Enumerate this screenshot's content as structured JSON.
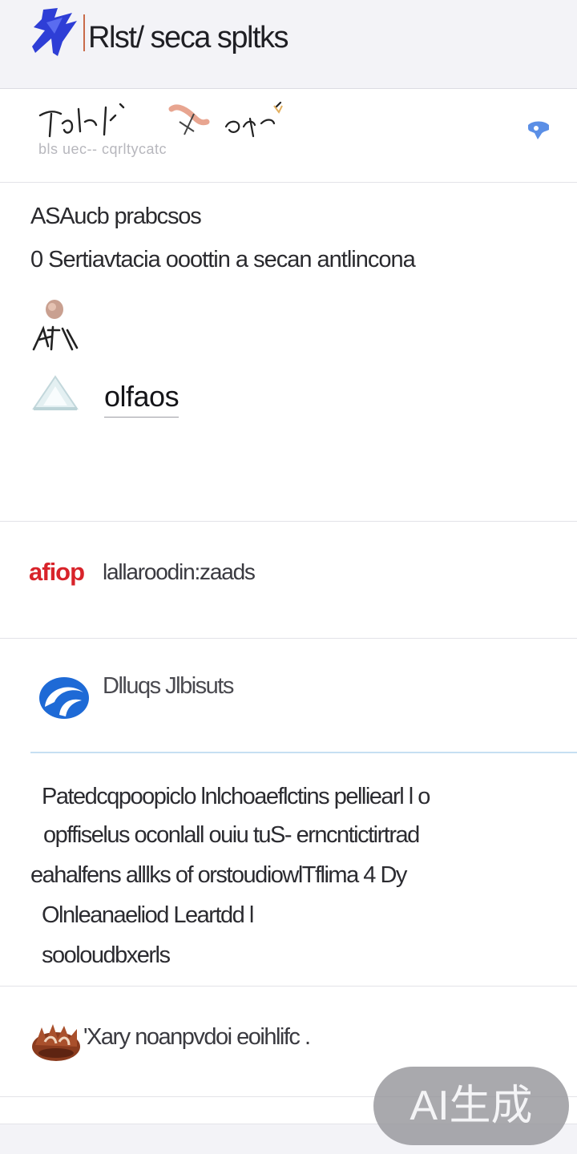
{
  "header": {
    "title": "Rlst/ seca spltks"
  },
  "profile": {
    "caption": "bls  uec-- cqrltycatc"
  },
  "section": {
    "heading": "ASAucb prabcsos",
    "subtitle": "0 Sertiavtacia ooottin a secan antlincona",
    "action_label": "olfaos"
  },
  "app_row": {
    "badge": "afiop",
    "label": "lallaroodin:zaads"
  },
  "service_row": {
    "title": "Dlluqs  Jlbisuts"
  },
  "paragraph": {
    "lines": [
      "Patedcqpoopiclo lnlchoaeflctins pelliearl l o",
      "opffiselus oconlall ouiu tuS- erncntictirtrad",
      "eahalfens alllks of orstoudiowlTflima 4 Dy",
      "Olnleanaeliod Leartdd l",
      "sooloudbxerls"
    ]
  },
  "last_item": {
    "label": "'Xary noanpvdoi eoihlifc ."
  },
  "watermark": {
    "text": "AI生成"
  },
  "colors": {
    "header_bg": "#f3f3f7",
    "accent_blue": "#2a78d8",
    "badge_red": "#d8232a",
    "brand_blue": "#2e3ed6"
  }
}
